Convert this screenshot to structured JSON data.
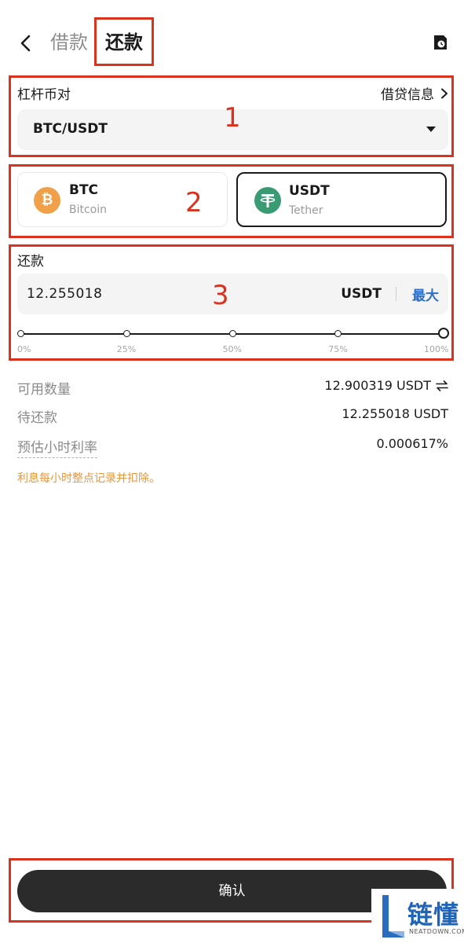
{
  "header": {
    "tabs": [
      {
        "label": "借款",
        "active": false
      },
      {
        "label": "还款",
        "active": true
      }
    ],
    "back_icon": "chevron-left-icon",
    "history_icon": "history-clock-icon"
  },
  "pair": {
    "label": "杠杆币对",
    "info_link": "借贷信息",
    "selected": "BTC/USDT"
  },
  "coins": [
    {
      "symbol": "BTC",
      "name": "Bitcoin",
      "icon": "bitcoin-icon",
      "selected": false
    },
    {
      "symbol": "USDT",
      "name": "Tether",
      "icon": "tether-icon",
      "selected": true
    }
  ],
  "repay": {
    "label": "还款",
    "amount": "12.255018",
    "unit": "USDT",
    "max_label": "最大",
    "slider_percent": 100,
    "slider_marks": [
      "0%",
      "25%",
      "50%",
      "75%",
      "100%"
    ]
  },
  "info": {
    "available_label": "可用数量",
    "available_value": "12.900319 USDT",
    "pending_label": "待还款",
    "pending_value": "12.255018 USDT",
    "rate_label": "预估小时利率",
    "rate_value": "0.000617%"
  },
  "notice": "利息每小时整点记录并扣除。",
  "confirm_label": "确认",
  "annotations": [
    "1",
    "2",
    "3"
  ],
  "watermark": {
    "text": "链懂",
    "sub": "NEATDOWN.COM"
  },
  "colors": {
    "accent_blue": "#2d6fc4",
    "notice_orange": "#e8963a",
    "annotation_red": "#d9331f",
    "button_dark": "#2b2b2b",
    "btc_orange": "#f0a048",
    "usdt_green": "#3a9a74"
  }
}
